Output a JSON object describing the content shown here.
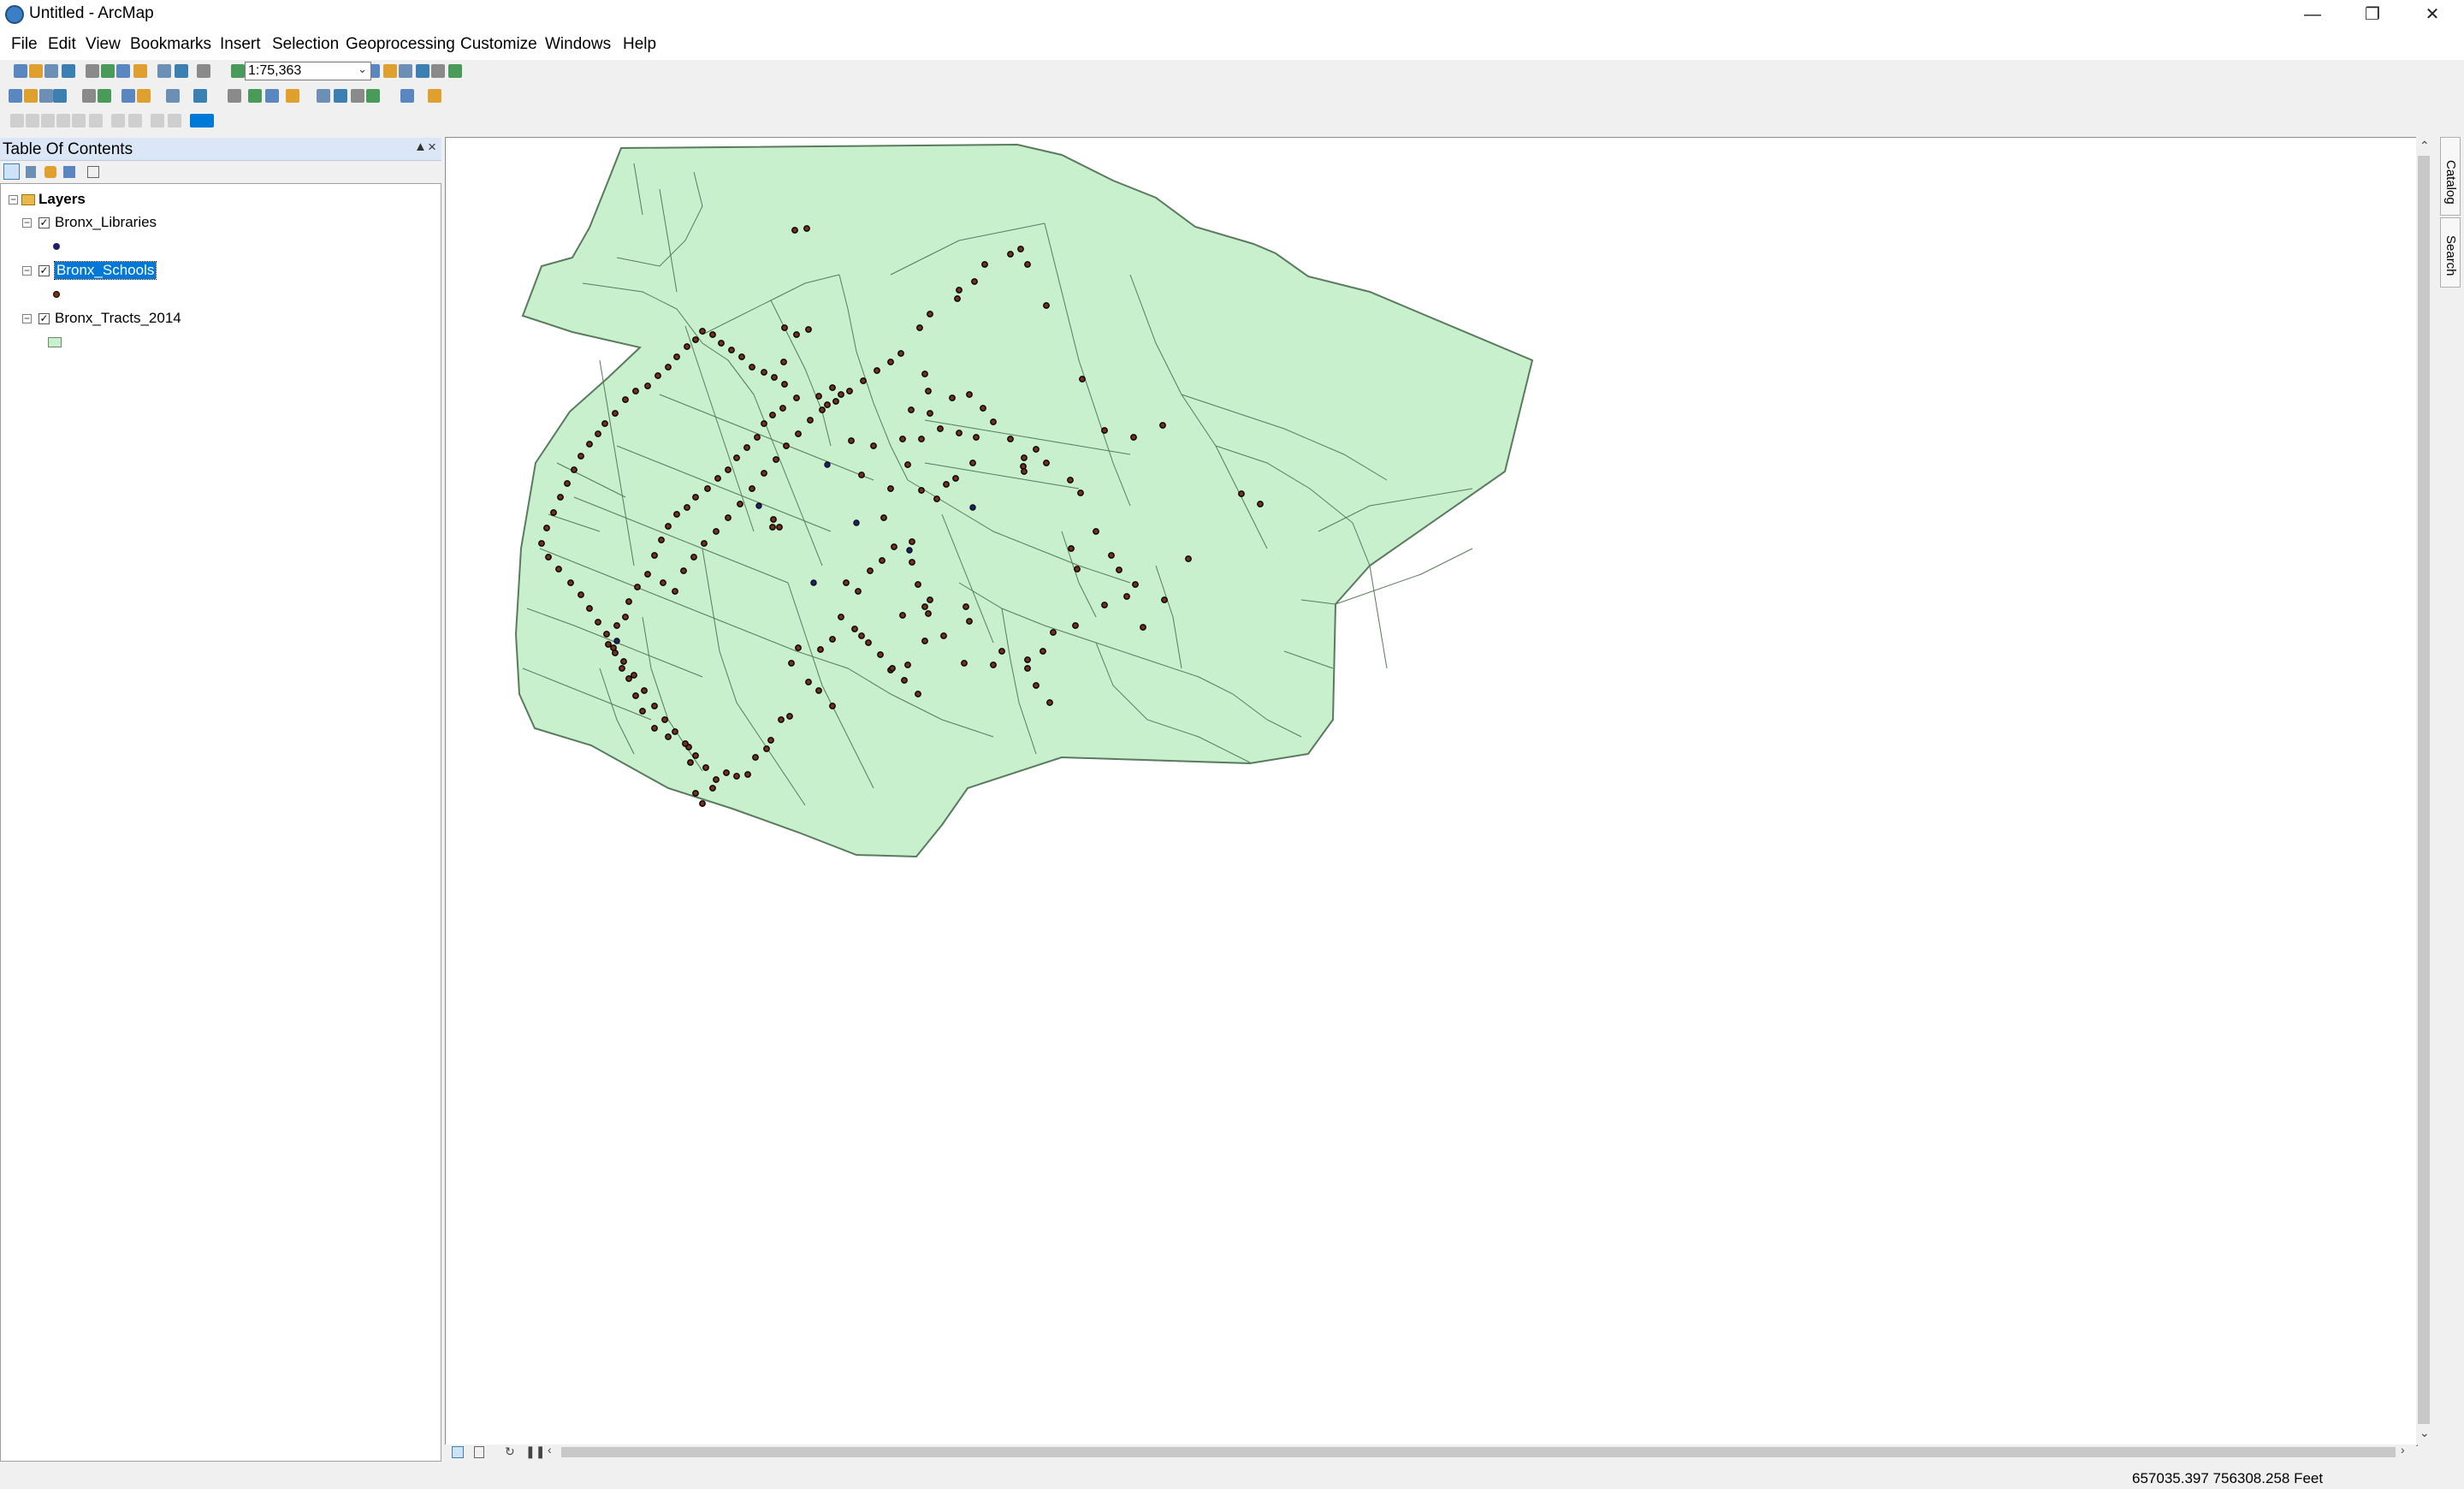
{
  "window": {
    "title": "Untitled - ArcMap",
    "app_icon": "arcmap-globe-icon",
    "controls": [
      "minimize-icon",
      "restore-icon",
      "close-icon"
    ]
  },
  "menu": [
    "File",
    "Edit",
    "View",
    "Bookmarks",
    "Insert",
    "Selection",
    "Geoprocessing",
    "Customize",
    "Windows",
    "Help"
  ],
  "toolbar": {
    "scale": "1:75,363",
    "icons": [
      "new-icon",
      "open-icon",
      "save-icon",
      "print-icon",
      "cut-icon",
      "copy-icon",
      "paste-icon",
      "delete-icon",
      "undo-icon",
      "redo-icon",
      "add-data-icon",
      "editor-icon",
      "table-of-contents-icon",
      "catalog-icon",
      "search-icon",
      "arctoolbox-icon",
      "python-icon",
      "model-builder-icon",
      "zoom-in-icon",
      "zoom-out-icon",
      "pan-icon",
      "full-extent-icon",
      "fixed-zoom-in-icon",
      "fixed-zoom-out-icon",
      "back-icon",
      "forward-icon",
      "select-features-icon",
      "clear-selection-icon",
      "select-elements-icon",
      "identify-icon",
      "hyperlink-icon",
      "html-popup-icon",
      "measure-icon",
      "find-icon",
      "find-route-icon",
      "xy-icon",
      "time-slider-icon",
      "create-viewer-icon"
    ]
  },
  "toc": {
    "title": "Table Of Contents",
    "tabs": [
      "list-by-drawing-order-icon",
      "list-by-source-icon",
      "list-by-visibility-icon",
      "list-by-selection-icon",
      "options-icon"
    ],
    "root": "Layers",
    "layers": [
      {
        "name": "Bronx_Libraries",
        "checked": true,
        "symbol": "point",
        "symbol_color": "#1e1e6e"
      },
      {
        "name": "Bronx_Schools",
        "checked": true,
        "selected": true,
        "symbol": "point",
        "symbol_color": "#6b2a10"
      },
      {
        "name": "Bronx_Tracts_2014",
        "checked": true,
        "symbol": "polygon",
        "symbol_color": "#c8f0cc"
      }
    ]
  },
  "dock": [
    "Catalog",
    "Search"
  ],
  "status": {
    "coordinates": "657035.397  756308.258 Feet"
  },
  "colors": {
    "accent": "#0078d7",
    "polygon_fill": "#c8f0cc",
    "polygon_stroke": "#5a7a5e",
    "school_point": "#7a2e12",
    "library_point": "#1e1e6e"
  }
}
